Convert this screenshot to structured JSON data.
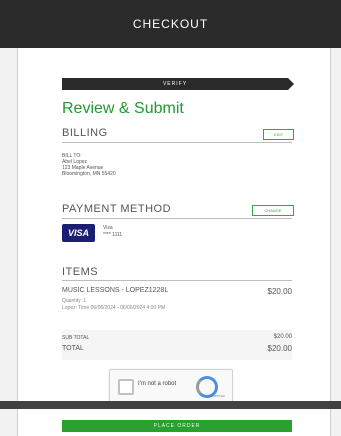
{
  "header": {
    "title": "CHECKOUT"
  },
  "step": {
    "label": "VERIFY"
  },
  "review": {
    "title": "Review & Submit"
  },
  "billing": {
    "heading": "BILLING",
    "edit_label": "EDIT",
    "address_lines": [
      "BILL TO:",
      "Abel Lopez",
      "123 Maple Avenue",
      "Bloomington, MN 55420"
    ]
  },
  "payment": {
    "heading": "PAYMENT METHOD",
    "change_label": "CHANGE",
    "card_brand": "VISA",
    "card_type": "Visa",
    "card_number": "**** 1111"
  },
  "items": {
    "heading": "ITEMS",
    "list": [
      {
        "name": "MUSIC LESSONS - LOPEZ1228L",
        "price": "$20.00",
        "quantity": "Quantity: 1",
        "details": "Lopez: Time 06/06/2024 - 06/06/2024 4:00 PM"
      }
    ]
  },
  "totals": {
    "subtotal_label": "SUB TOTAL",
    "subtotal_value": "$20.00",
    "total_label": "TOTAL",
    "total_value": "$20.00"
  },
  "captcha": {
    "label": "I'm not a robot",
    "brand": "reCAPTCHA"
  },
  "actions": {
    "place_order_label": "PLACE ORDER"
  },
  "colors": {
    "accent": "#2aa02f",
    "header_bg": "#2b2b2b"
  }
}
